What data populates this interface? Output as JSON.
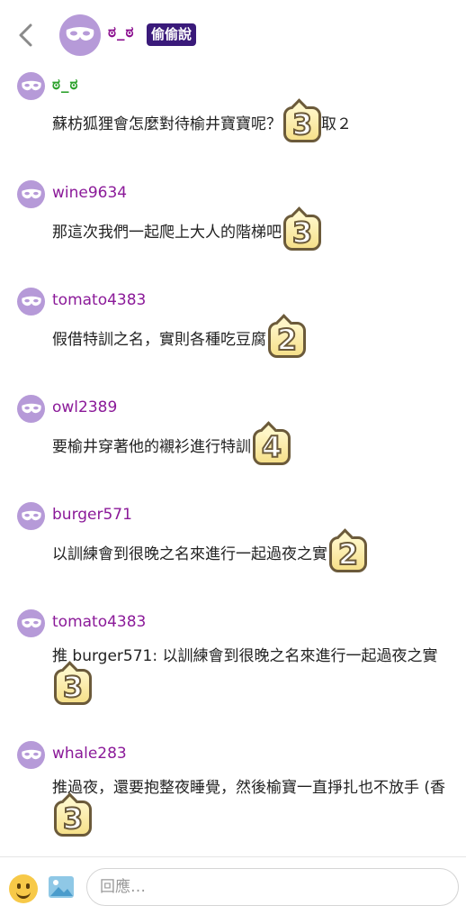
{
  "header": {
    "author": "ಠ_ಠ",
    "badge": "偷偷說"
  },
  "colors": {
    "avatar": "#b69ad8",
    "username": "#8b1a99",
    "badge_bg": "#3a1a7a",
    "op_name": "#2ba12b"
  },
  "comments": [
    {
      "user": "ಠ_ಠ",
      "text": "蘇枋狐狸會怎麼對待榆井寶寶呢？",
      "sticker": "3",
      "after": "取２"
    },
    {
      "user": "wine9634",
      "text": "那這次我們一起爬上大人的階梯吧",
      "sticker": "3",
      "after": ""
    },
    {
      "user": "tomato4383",
      "text": "假借特訓之名，實則各種吃豆腐",
      "sticker": "2",
      "after": ""
    },
    {
      "user": "owl2389",
      "text": "要榆井穿著他的襯衫進行特訓",
      "sticker": "4",
      "after": ""
    },
    {
      "user": "burger571",
      "text": "以訓練會到很晚之名來進行一起過夜之實",
      "sticker": "2",
      "after": ""
    },
    {
      "user": "tomato4383",
      "text": "推 burger571: 以訓練會到很晚之名來進行一起過夜之實",
      "sticker": "3",
      "after": ""
    },
    {
      "user": "whale283",
      "text": "推過夜，還要抱整夜睡覺，然後榆寶一直掙扎也不放手 (香",
      "sticker": "3",
      "after": ""
    }
  ],
  "footer": {
    "reply_placeholder": "回應…"
  }
}
